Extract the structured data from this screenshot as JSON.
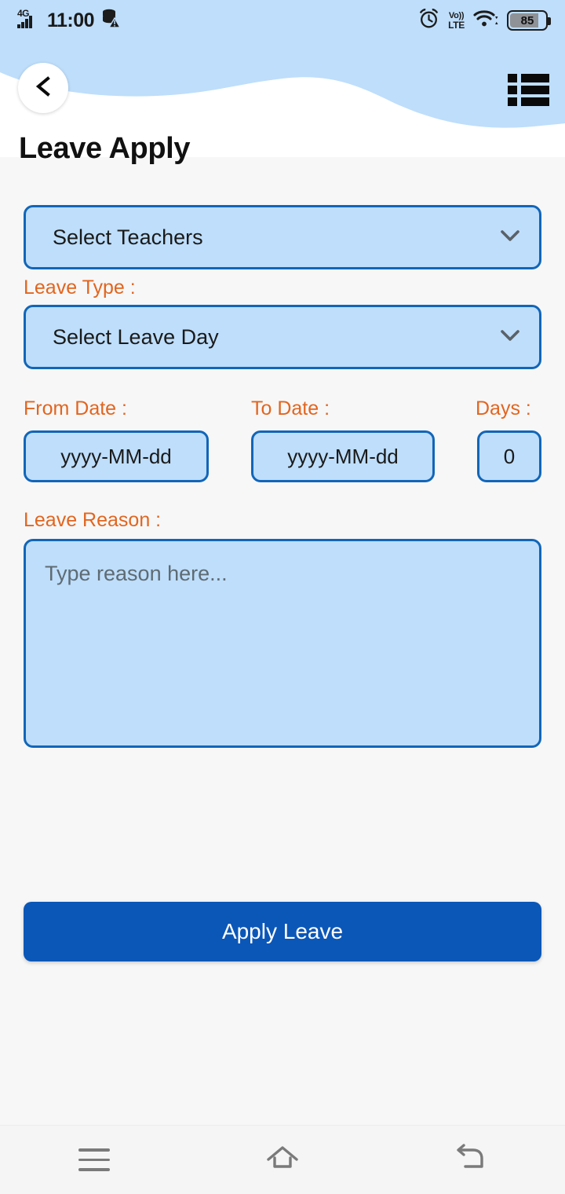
{
  "status_bar": {
    "network_label": "4G",
    "network_sup": "G",
    "time": "11:00",
    "data_icon": "data-saver-off-icon",
    "alarm_icon": "alarm-clock-icon",
    "volte_top": "Vo))",
    "volte_bottom": "LTE",
    "wifi_icon": "wifi-icon",
    "battery_level": "85"
  },
  "header": {
    "back_icon": "chevron-left-icon",
    "list_icon": "list-view-icon",
    "wave_color": "#bedefb",
    "surface_color": "#ffffff"
  },
  "page": {
    "title": "Leave Apply",
    "background": "#f7f7f7"
  },
  "form": {
    "teacher_select": {
      "value": "Select Teachers",
      "chevron_icon": "chevron-down-icon"
    },
    "leave_type": {
      "label": "Leave Type :",
      "value": "Select Leave Day",
      "chevron_icon": "chevron-down-icon"
    },
    "from_date": {
      "label": "From Date :",
      "placeholder": "yyyy-MM-dd"
    },
    "to_date": {
      "label": "To Date :",
      "placeholder": "yyyy-MM-dd"
    },
    "days": {
      "label": "Days :",
      "value": "0"
    },
    "leave_reason": {
      "label": "Leave Reason :",
      "placeholder": "Type reason here..."
    },
    "submit": {
      "label": "Apply Leave"
    }
  },
  "colors": {
    "accent_blue": "#0b57b8",
    "field_border": "#1266b8",
    "field_fill": "#bedefb",
    "label_orange": "#e2651f"
  },
  "navbar": {
    "recents_icon": "menu-icon",
    "home_icon": "home-icon",
    "back_icon": "back-arrow-icon"
  }
}
